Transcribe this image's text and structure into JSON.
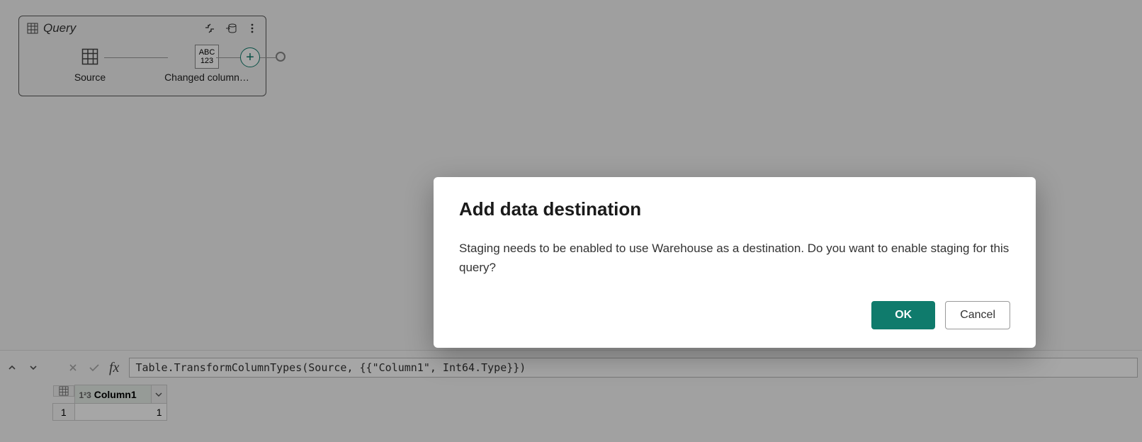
{
  "query_card": {
    "title": "Query",
    "steps": [
      {
        "label": "Source"
      },
      {
        "label": "Changed column…",
        "type_badge_top": "ABC",
        "type_badge_bot": "123"
      }
    ]
  },
  "formula_bar": {
    "formula": "Table.TransformColumnTypes(Source, {{\"Column1\", Int64.Type}})"
  },
  "grid": {
    "column_header": "Column1",
    "type_prefix": "1²3",
    "rows": [
      {
        "index": "1",
        "value": "1"
      }
    ]
  },
  "dialog": {
    "title": "Add data destination",
    "body": "Staging needs to be enabled to use Warehouse as a destination. Do you want to enable staging for this query?",
    "ok_label": "OK",
    "cancel_label": "Cancel"
  },
  "colors": {
    "accent": "#0f7b6c"
  }
}
